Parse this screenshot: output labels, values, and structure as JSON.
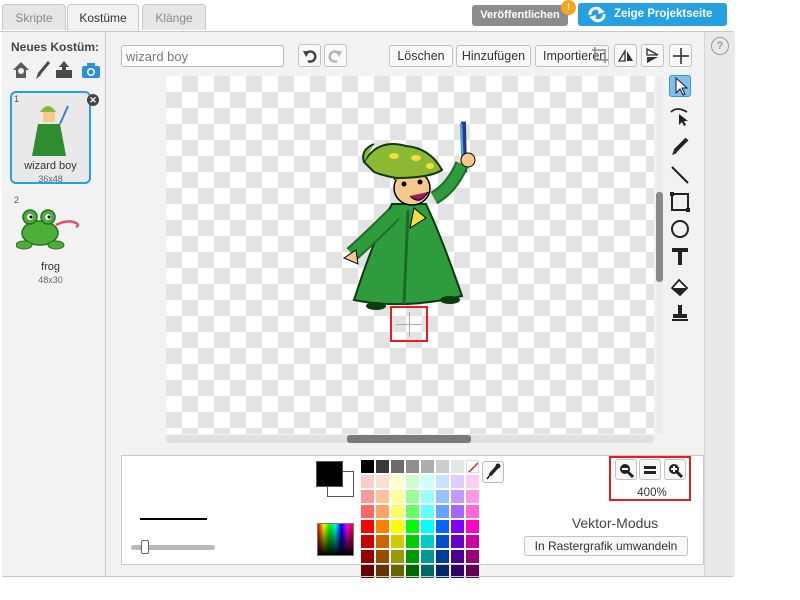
{
  "tabs": [
    {
      "label": "Skripte"
    },
    {
      "label": "Kostüme"
    },
    {
      "label": "Klänge"
    }
  ],
  "header": {
    "publish_label": "Veröffentlichen",
    "publish_badge": "!",
    "project_page_label": "Zeige Projektseite"
  },
  "costumes_panel": {
    "new_costume_label": "Neues Kostüm:",
    "new_costume_tools": [
      "sprite-library-icon",
      "paint-brush-icon",
      "upload-icon",
      "camera-icon"
    ],
    "items": [
      {
        "index": "1",
        "name": "wizard boy",
        "size": "36x48",
        "selected": true
      },
      {
        "index": "2",
        "name": "frog",
        "size": "48x30",
        "selected": false
      }
    ]
  },
  "editor": {
    "costume_name": "wizard boy",
    "clear_label": "Löschen",
    "add_label": "Hinzufügen",
    "import_label": "Importieren",
    "paint_tools": [
      "select-icon",
      "reshape-icon",
      "pencil-icon",
      "line-icon",
      "rectangle-icon",
      "ellipse-icon",
      "text-icon",
      "fill-icon",
      "stamp-icon"
    ],
    "help_label": "?"
  },
  "bottom_bar": {
    "zoom_level": "400%",
    "mode_label": "Vektor-Modus",
    "convert_label": "In Rastergrafik umwandeln",
    "foreground_color": "#000000",
    "background_color": "#ffffff",
    "palette": [
      "#000000",
      "#393939",
      "#6b6b6b",
      "#8e8e8e",
      "#adadad",
      "#cccccc",
      "#e6e6e6",
      "#ffffff",
      "#ffcccc",
      "#ffe0cc",
      "#ffffcc",
      "#ccffcc",
      "#ccffff",
      "#cce0ff",
      "#e0ccff",
      "#ffccf2",
      "#ff9999",
      "#ffc299",
      "#ffff99",
      "#99ff99",
      "#99ffff",
      "#99c2ff",
      "#c299ff",
      "#ff99e6",
      "#ff6666",
      "#ffa366",
      "#ffff66",
      "#66ff66",
      "#66ffff",
      "#66a3ff",
      "#a366ff",
      "#ff66d9",
      "#ff0000",
      "#ff8000",
      "#ffff00",
      "#00ff00",
      "#00ffff",
      "#0066ff",
      "#8000ff",
      "#ff00cc",
      "#cc0000",
      "#cc6600",
      "#cccc00",
      "#00cc00",
      "#00cccc",
      "#0052cc",
      "#6600cc",
      "#cc00a3",
      "#990000",
      "#994c00",
      "#999900",
      "#009900",
      "#009999",
      "#003d99",
      "#4c0099",
      "#99007a",
      "#660000",
      "#663300",
      "#666600",
      "#006600",
      "#006666",
      "#002966",
      "#330066",
      "#660052"
    ]
  },
  "colors": {
    "accent_blue": "#25a0e0",
    "publish_gray": "#8c8c8c",
    "warning_orange": "#f7a51c",
    "highlight_red": "#e02020"
  }
}
